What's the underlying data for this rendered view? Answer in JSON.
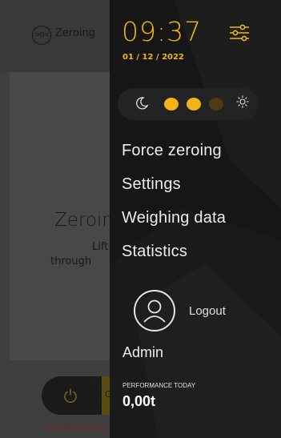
{
  "background": {
    "header_label": "Zeroing",
    "header_icon_glyph": ">0<",
    "title": "Zeroin",
    "line1": "Lift",
    "line2": "through",
    "power_icon": "power-icon",
    "power_right_glyph": "C",
    "footer": "Checkweigher |"
  },
  "drawer": {
    "time": "09:37",
    "date": "01 / 12 / 2022",
    "menu": [
      "Force zeroing",
      "Settings",
      "Weighing data",
      "Statistics"
    ],
    "theme": {
      "mode_icons": [
        "moon-icon",
        "sun-icon"
      ],
      "level": 2,
      "levels": 3
    },
    "logout": "Logout",
    "user": "Admin",
    "performance_label": "PERFORMANCE TODAY",
    "performance_value": "0,00t"
  },
  "colors": {
    "accent": "#f2b418",
    "drawer_bg": "#161616"
  }
}
